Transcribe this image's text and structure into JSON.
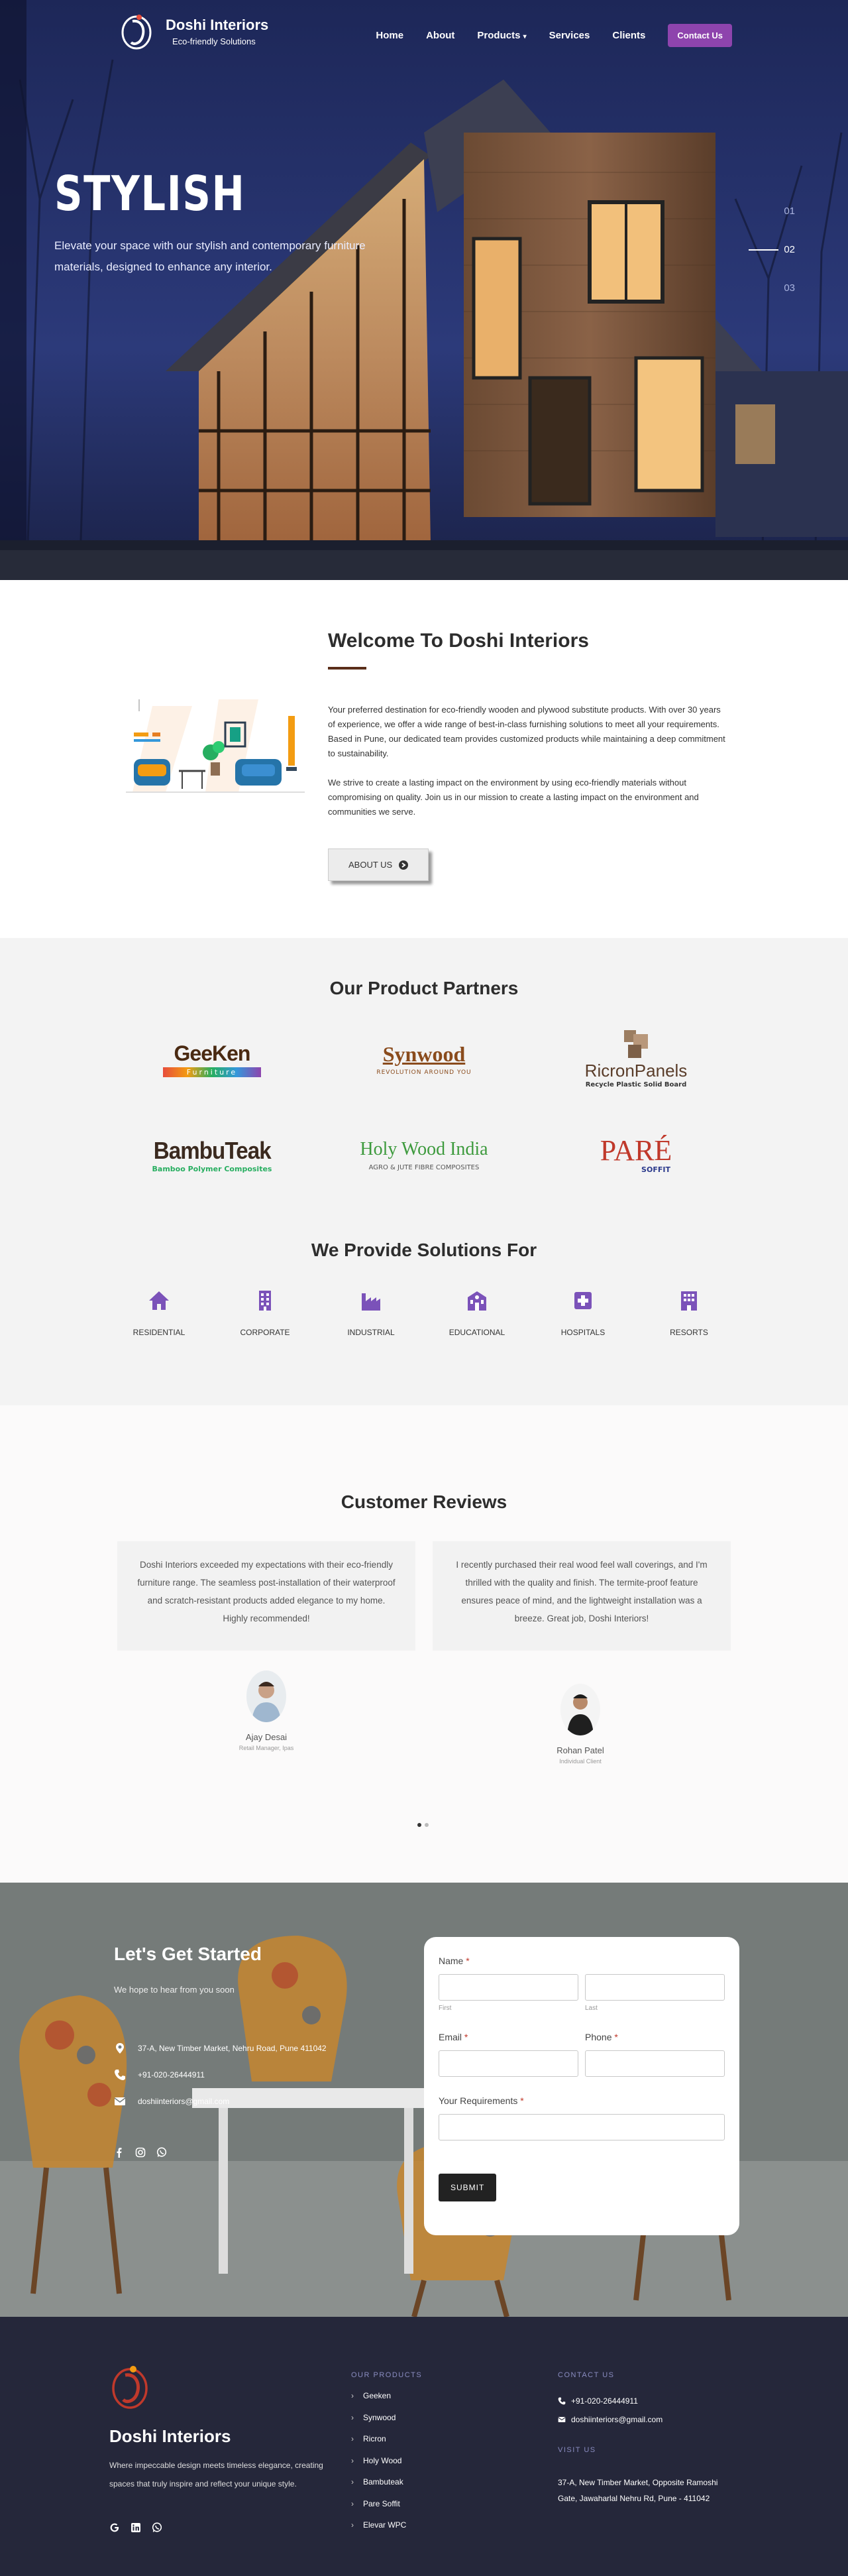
{
  "brand": {
    "name": "Doshi Interiors",
    "tagline": "Eco-friendly Solutions"
  },
  "nav": {
    "items": [
      "Home",
      "About",
      "Products",
      "Services",
      "Clients"
    ],
    "contact_label": "Contact Us"
  },
  "hero": {
    "title": "STYLISH",
    "subtitle": "Elevate your space with our stylish and contemporary furniture materials, designed to enhance any interior.",
    "slides": [
      "01",
      "02",
      "03"
    ],
    "active_slide": "02"
  },
  "welcome": {
    "title": "Welcome To Doshi Interiors",
    "p1": "Your preferred destination for eco-friendly wooden and plywood substitute products. With over 30 years of experience, we offer a wide range of best-in-class furnishing solutions to meet all your requirements. Based in Pune, our dedicated team provides customized products while maintaining a deep commitment to sustainability.",
    "p2": "We strive to create a lasting impact on the environment by using eco-friendly materials without compromising on quality. Join us in our mission to create a lasting impact on the environment and communities we serve.",
    "button": "ABOUT US"
  },
  "partners": {
    "title": "Our Product Partners",
    "logos": {
      "geeken": {
        "main": "GeeKen",
        "sub": "Furniture"
      },
      "synwood": {
        "main": "Synwood",
        "sub": "REVOLUTION AROUND YOU"
      },
      "ricron": {
        "main": "RicronPanels",
        "sub": "Recycle Plastic Solid Board"
      },
      "bambuteak": {
        "main": "BambuTeak",
        "sub": "Bamboo Polymer Composites"
      },
      "holywood": {
        "main": "Holy Wood India",
        "sub": "AGRO & JUTE FIBRE COMPOSITES"
      },
      "pare": {
        "main": "PARÉ",
        "sub": "SOFFIT"
      }
    }
  },
  "solutions": {
    "title": "We Provide Solutions For",
    "items": [
      "RESIDENTIAL",
      "CORPORATE",
      "INDUSTRIAL",
      "EDUCATIONAL",
      "HOSPITALS",
      "RESORTS"
    ]
  },
  "reviews": {
    "title": "Customer Reviews",
    "items": [
      {
        "text": "Doshi Interiors exceeded my expectations with their eco-friendly furniture range. The seamless post-installation of their waterproof and scratch-resistant products added elegance to my home. Highly recommended!",
        "name": "Ajay Desai",
        "role": "Retail Manager, Ipas"
      },
      {
        "text": "I recently purchased their real wood feel wall coverings, and I'm thrilled with the quality and finish. The termite-proof feature ensures peace of mind, and the lightweight installation was a breeze. Great job, Doshi Interiors!",
        "name": "Rohan Patel",
        "role": "Individual Client"
      }
    ]
  },
  "contact": {
    "title": "Let's Get Started",
    "hope": "We hope to hear from you soon",
    "address": "37-A, New Timber Market, Nehru Road, Pune 411042",
    "phone": "+91-020-26444911",
    "email": "doshiinteriors@gmail.com",
    "form": {
      "name_label": "Name",
      "first": "First",
      "last": "Last",
      "email_label": "Email",
      "phone_label": "Phone",
      "req_label": "Your Requirements",
      "submit": "SUBMIT"
    }
  },
  "footer": {
    "brand": "Doshi Interiors",
    "desc": "Where impeccable design meets timeless elegance, creating spaces that truly inspire and reflect your unique style.",
    "products_title": "OUR PRODUCTS",
    "products": [
      "Geeken",
      "Synwood",
      "Ricron",
      "Holy Wood",
      "Bambuteak",
      "Pare Soffit",
      "Elevar WPC"
    ],
    "contact_title": "CONTACT US",
    "phone": "+91-020-26444911",
    "email": "doshiinteriors@gmail.com",
    "visit_title": "VISIT US",
    "address": "37-A, New Timber Market, Opposite Ramoshi Gate, Jawaharlal Nehru Rd, Pune - 411042"
  },
  "colors": {
    "accent": "#8e44ad",
    "dark": "#25273a",
    "brown": "#5a2e1a",
    "icon": "#7b52b9"
  }
}
